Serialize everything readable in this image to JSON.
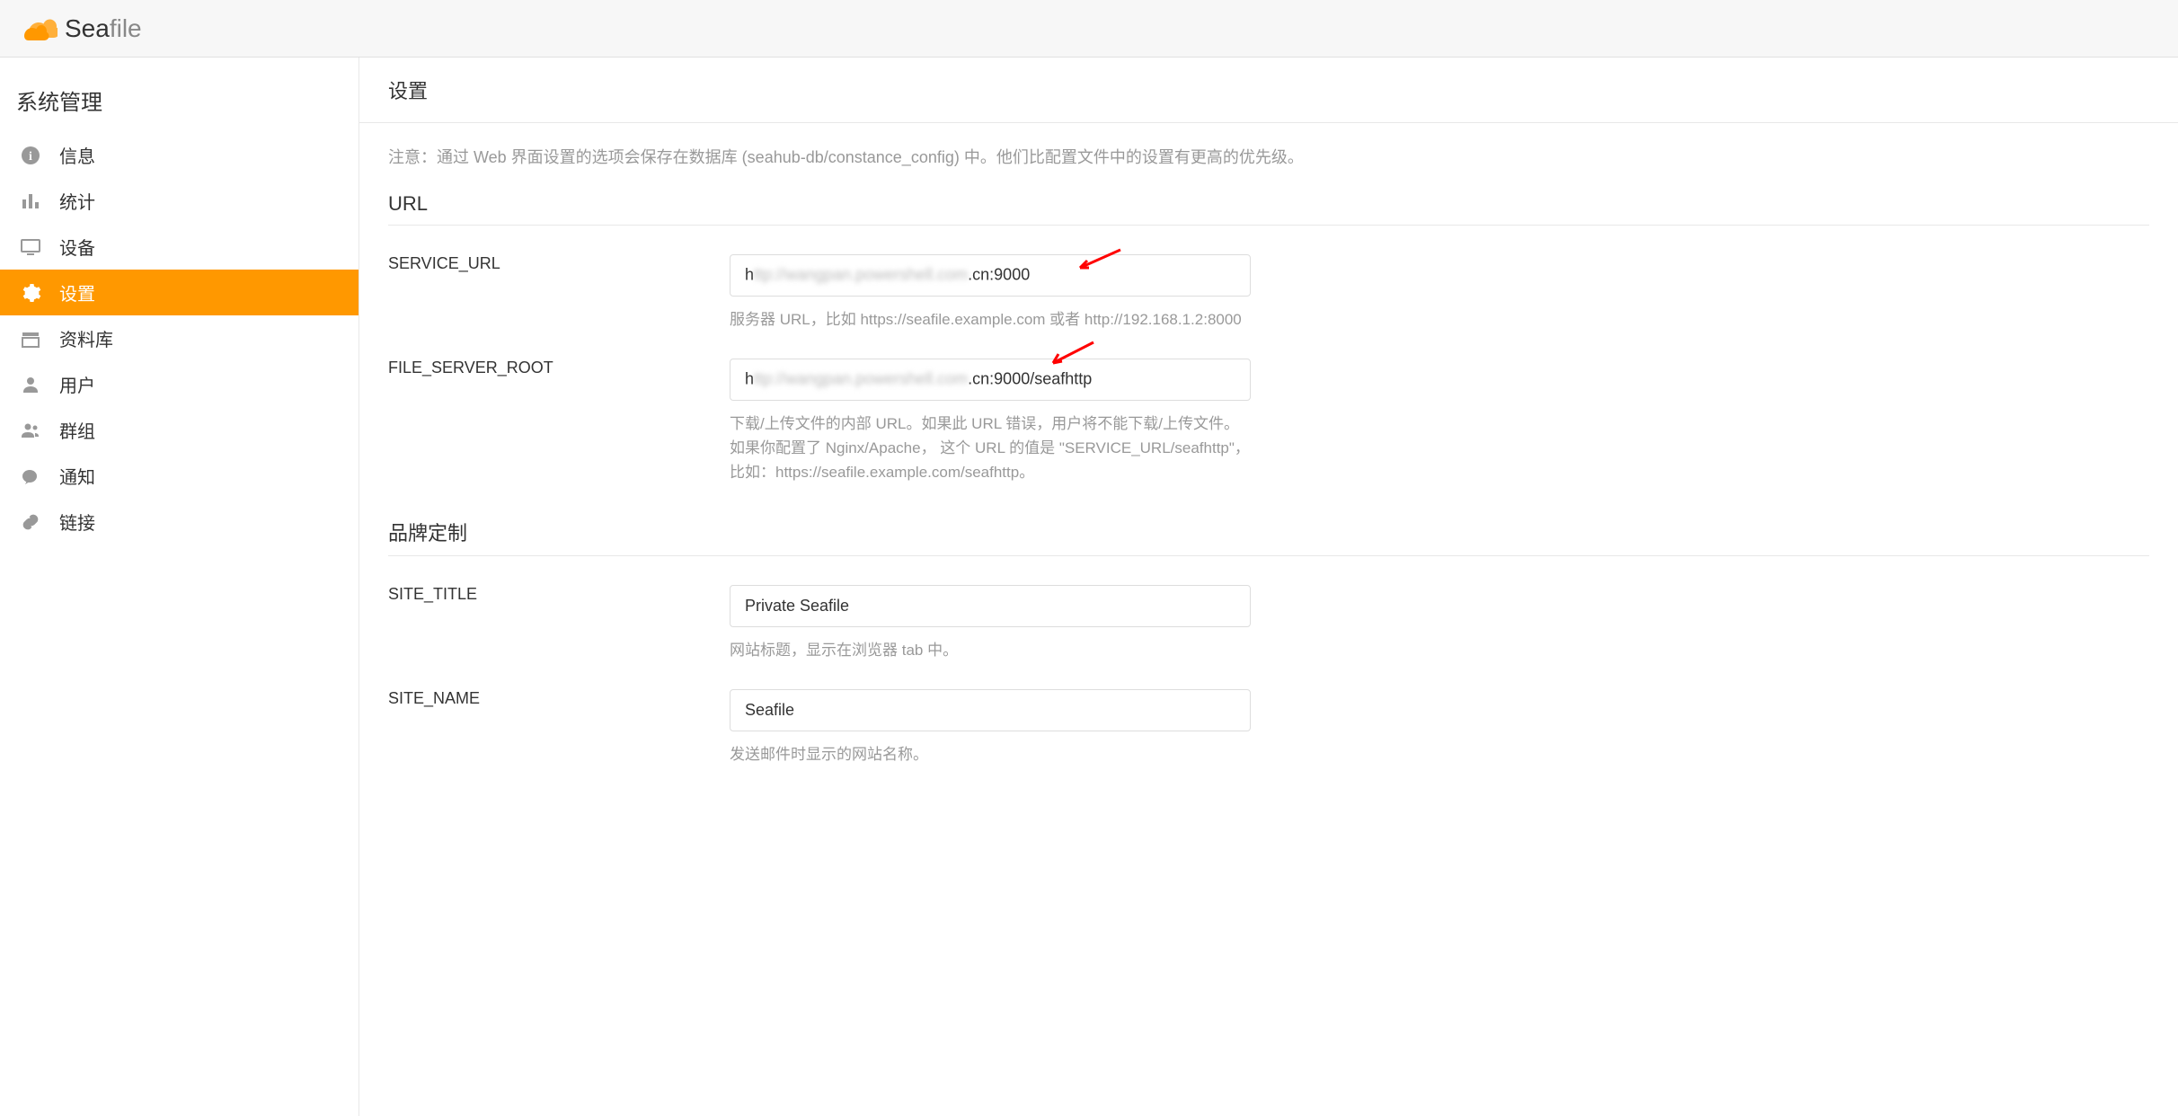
{
  "header": {
    "logo_text_1": "Sea",
    "logo_text_2": "file"
  },
  "sidebar": {
    "title": "系统管理",
    "items": [
      {
        "icon": "info-icon",
        "label": "信息"
      },
      {
        "icon": "stats-icon",
        "label": "统计"
      },
      {
        "icon": "device-icon",
        "label": "设备"
      },
      {
        "icon": "gear-icon",
        "label": "设置",
        "active": true
      },
      {
        "icon": "library-icon",
        "label": "资料库"
      },
      {
        "icon": "user-icon",
        "label": "用户"
      },
      {
        "icon": "group-icon",
        "label": "群组"
      },
      {
        "icon": "notification-icon",
        "label": "通知"
      },
      {
        "icon": "link-icon",
        "label": "链接"
      }
    ]
  },
  "main": {
    "page_title": "设置",
    "notice": "注意：通过 Web 界面设置的选项会保存在数据库 (seahub-db/constance_config) 中。他们比配置文件中的设置有更高的优先级。",
    "sections": [
      {
        "title": "URL",
        "settings": [
          {
            "label": "SERVICE_URL",
            "value_prefix": "h",
            "value_blurred": "ttp://wangpan.powershell.com",
            "value_suffix": ".cn:9000",
            "help": "服务器 URL，比如 https://seafile.example.com 或者 http://192.168.1.2:8000",
            "has_arrow": true
          },
          {
            "label": "FILE_SERVER_ROOT",
            "value_prefix": "h",
            "value_blurred": "ttp://wangpan.powershell.com",
            "value_suffix": ".cn:9000/seafhttp",
            "help": "下载/上传文件的内部 URL。如果此 URL 错误，用户将不能下载/上传文件。如果你配置了 Nginx/Apache， 这个 URL 的值是 \"SERVICE_URL/seafhttp\"，比如：https://seafile.example.com/seafhttp。",
            "has_arrow": true
          }
        ]
      },
      {
        "title": "品牌定制",
        "settings": [
          {
            "label": "SITE_TITLE",
            "value": "Private Seafile",
            "help": "网站标题，显示在浏览器 tab 中。"
          },
          {
            "label": "SITE_NAME",
            "value": "Seafile",
            "help": "发送邮件时显示的网站名称。"
          }
        ]
      }
    ]
  }
}
